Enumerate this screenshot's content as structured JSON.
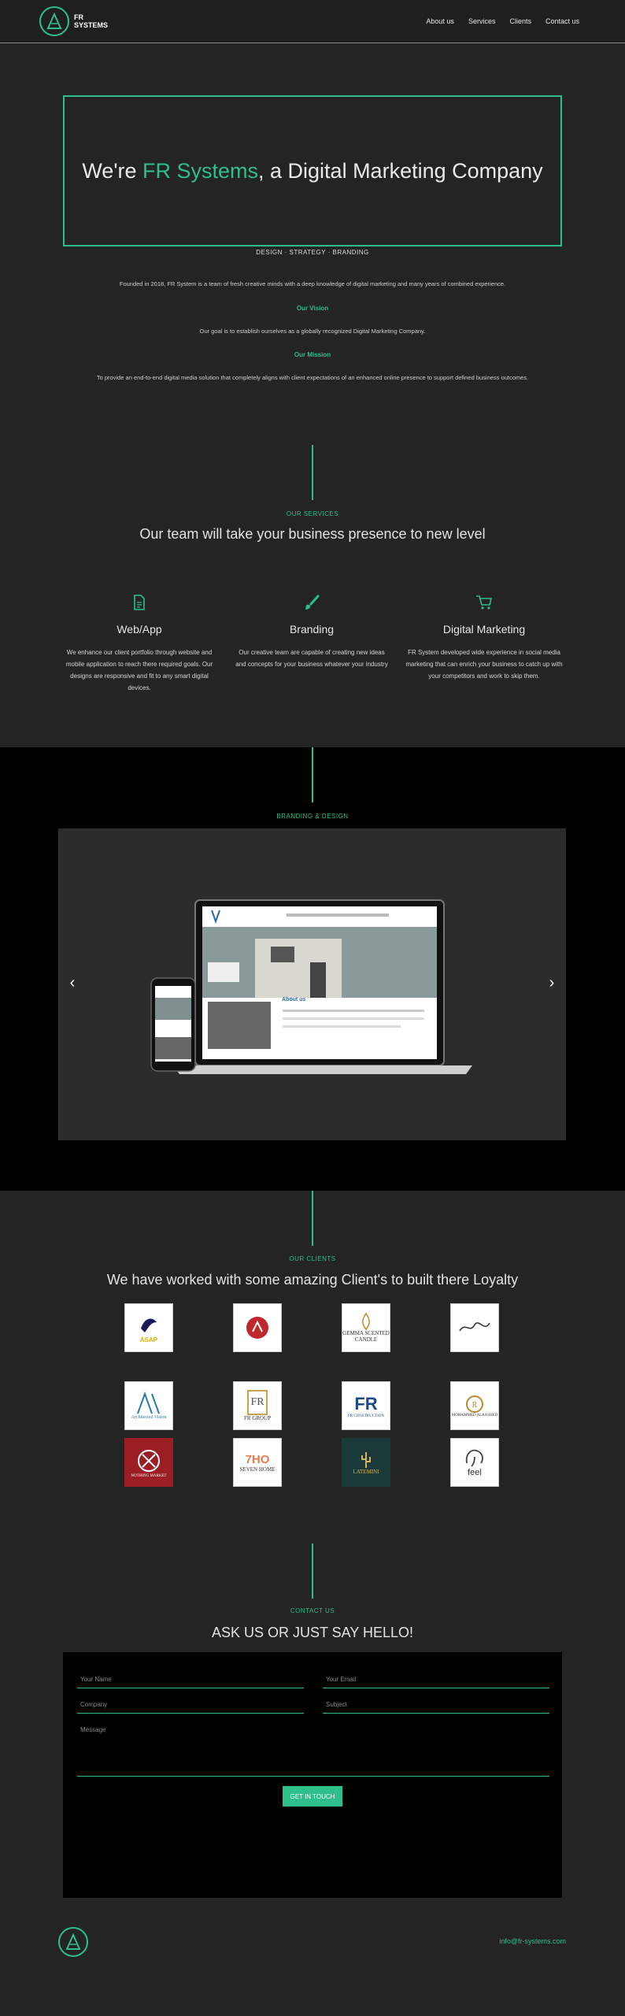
{
  "brand": {
    "line1": "FR",
    "line2": "SYSTEMS"
  },
  "nav": [
    "About us",
    "Services",
    "Clients",
    "Contact us"
  ],
  "hero": {
    "prefix": "We're ",
    "accent": "FR Systems",
    "suffix": ", a Digital Marketing Company",
    "tagline": "DESIGN  ·  STRATEGY  ·  BRANDING"
  },
  "about": {
    "intro": "Founded in 2018, FR System is a team of fresh creative minds with a deep knowledge of digital marketing and many years of combined experience.",
    "vision_title": "Our Vision",
    "vision": "Our goal is to establish ourselves as a globally recognized Digital Marketing Company.",
    "mission_title": "Our Mission",
    "mission": "To provide an end-to-end digital media solution that completely aligns with client expectations of an enhanced online presence to support defined business outcomes."
  },
  "services": {
    "label": "OUR SERVICES",
    "title": "Our team will take your business presence to new level",
    "items": [
      {
        "icon": "document-icon",
        "name": "Web/App",
        "desc": "We enhance our client portfolio through website and mobile application to reach there required goals. Our designs are responsive and fit to any smart digital devices."
      },
      {
        "icon": "brush-icon",
        "name": "Branding",
        "desc": "Our creative team are capable of creating new ideas and concepts for your business whatever your industry"
      },
      {
        "icon": "cart-icon",
        "name": "Digital Marketing",
        "desc": "FR System developed wide experience in social media marketing that can enrich your business to catch up with your competitors and work to skip them."
      }
    ]
  },
  "branding": {
    "label": "BRANDING & DESIGN",
    "slide_heading": "About us",
    "prev": "‹",
    "next": "›"
  },
  "clients": {
    "label": "OUR CLIENTS",
    "title": "We have worked with some amazing Client's to built there Loyalty",
    "logos": [
      "ASAP",
      "",
      "GEMMA SCENTED CANDLE",
      "",
      "Architected Vision",
      "FR GROUP",
      "FR CONSTRUCTION",
      "MOHAMMED ALRASHED",
      "NOTHING MARKET",
      "SEVEN HOME",
      "LATEMINI",
      "feel"
    ]
  },
  "contact": {
    "label": "CONTACT US",
    "title": "ASK US OR JUST SAY HELLO!",
    "name_placeholder": "Your Name",
    "email_placeholder": "Your Email",
    "company_placeholder": "Company",
    "subject_placeholder": "Subject",
    "message_placeholder": "Message",
    "submit": "GET IN TOUCH"
  },
  "footer": {
    "email": "info@fr-systems.com"
  },
  "colors": {
    "accent": "#2fbf8a",
    "background": "#242424",
    "band": "#000000"
  }
}
